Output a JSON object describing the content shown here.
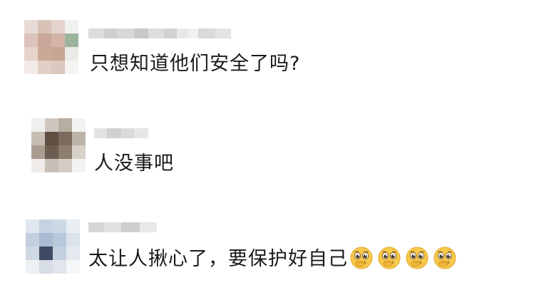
{
  "comments": [
    {
      "author": "",
      "text": "只想知道他们安全了吗?",
      "emoji_count": 0
    },
    {
      "author": "",
      "text": "人没事吧",
      "emoji_count": 0
    },
    {
      "author": "",
      "text": "太让人揪心了，要保护好自己",
      "emoji_count": 4,
      "emoji_name": "pleading-face-icon"
    }
  ],
  "colors": {
    "background": "#ffffff",
    "text": "#1a1a1a",
    "emoji_face": "#f7c84a"
  }
}
